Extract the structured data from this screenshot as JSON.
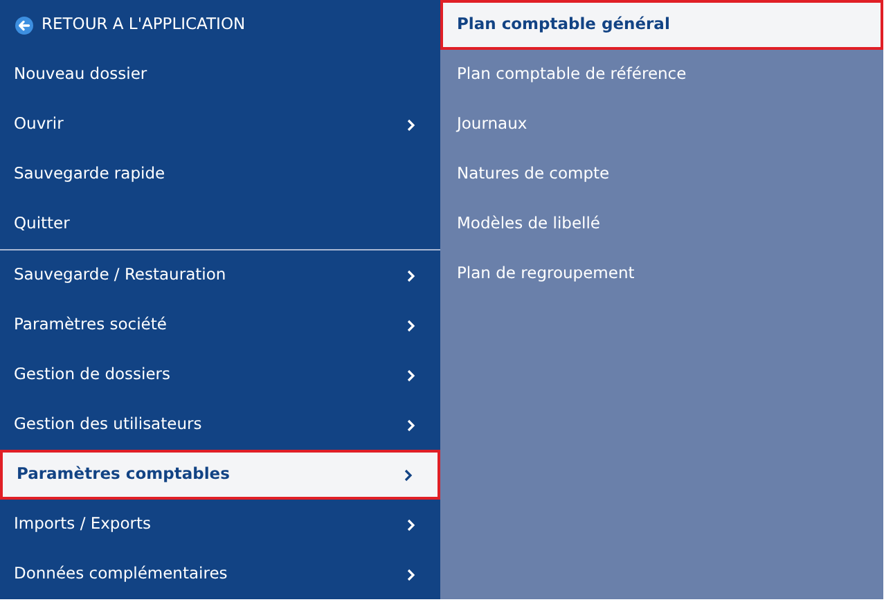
{
  "back_link": {
    "label": "RETOUR A L'APPLICATION"
  },
  "menu_sections": [
    [
      {
        "label": "Nouveau dossier",
        "submenu": false,
        "selected": false
      },
      {
        "label": "Ouvrir",
        "submenu": true,
        "selected": false
      },
      {
        "label": "Sauvegarde rapide",
        "submenu": false,
        "selected": false
      },
      {
        "label": "Quitter",
        "submenu": false,
        "selected": false
      }
    ],
    [
      {
        "label": "Sauvegarde / Restauration",
        "submenu": true,
        "selected": false
      },
      {
        "label": "Paramètres société",
        "submenu": true,
        "selected": false
      },
      {
        "label": "Gestion de dossiers",
        "submenu": true,
        "selected": false
      },
      {
        "label": "Gestion des utilisateurs",
        "submenu": true,
        "selected": false
      },
      {
        "label": "Paramètres comptables",
        "submenu": true,
        "selected": true
      },
      {
        "label": "Imports / Exports",
        "submenu": true,
        "selected": false
      },
      {
        "label": "Données complémentaires",
        "submenu": true,
        "selected": false
      }
    ]
  ],
  "submenu": [
    {
      "label": "Plan comptable général",
      "selected": true
    },
    {
      "label": "Plan comptable de référence",
      "selected": false
    },
    {
      "label": "Journaux",
      "selected": false
    },
    {
      "label": "Natures de compte",
      "selected": false
    },
    {
      "label": "Modèles de libellé",
      "selected": false
    },
    {
      "label": "Plan de regroupement",
      "selected": false
    }
  ]
}
